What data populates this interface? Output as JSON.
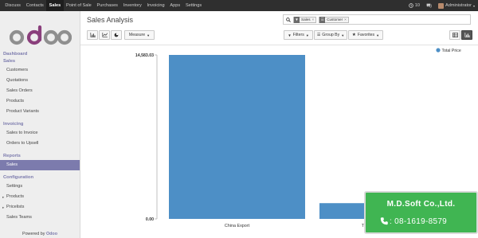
{
  "topbar": {
    "menu": [
      "Discuss",
      "Contacts",
      "Sales",
      "Point of Sale",
      "Purchases",
      "Inventory",
      "Invoicing",
      "Apps",
      "Settings"
    ],
    "active_menu": "Sales",
    "activity_count": "10",
    "user": "Administrator"
  },
  "sidebar": {
    "sections": [
      {
        "label": "Dashboard",
        "items": []
      },
      {
        "label": "Sales",
        "items": [
          {
            "label": "Customers"
          },
          {
            "label": "Quotations"
          },
          {
            "label": "Sales Orders"
          },
          {
            "label": "Products"
          },
          {
            "label": "Product Variants"
          }
        ]
      },
      {
        "label": "Invoicing",
        "items": [
          {
            "label": "Sales to Invoice"
          },
          {
            "label": "Orders to Upsell"
          }
        ]
      },
      {
        "label": "Reports",
        "items": [
          {
            "label": "Sales",
            "active": true
          }
        ]
      },
      {
        "label": "Configuration",
        "items": [
          {
            "label": "Settings"
          },
          {
            "label": "Products",
            "caret": true
          },
          {
            "label": "Pricelists",
            "caret": true
          },
          {
            "label": "Sales Teams"
          }
        ]
      }
    ],
    "powered_prefix": "Powered by",
    "powered_brand": "Odoo"
  },
  "main": {
    "title": "Sales Analysis",
    "facets": [
      {
        "label": "Sales",
        "icon": "filter-icon"
      },
      {
        "label": "Customer",
        "icon": "group-by-icon"
      }
    ],
    "buttons": {
      "measure": "Measure",
      "filters": "Filters",
      "group_by": "Group By",
      "favorites": "Favorites"
    }
  },
  "chart_data": {
    "type": "bar",
    "categories": [
      "China Export",
      "Think Big Systems"
    ],
    "series": [
      {
        "name": "Total Price",
        "values": [
          14583.03,
          1400
        ],
        "color": "#4d8fc6"
      }
    ],
    "ylim": [
      0,
      14583.03
    ],
    "yticks": [
      "0.00",
      "14,583.03"
    ],
    "visible_category_labels": [
      "China Export",
      "Think Big"
    ],
    "legend_position": "top-right"
  },
  "watermark": {
    "company": "M.D.Soft Co.,Ltd.",
    "phone": "08-1619-8579",
    "color": "#40b552"
  }
}
